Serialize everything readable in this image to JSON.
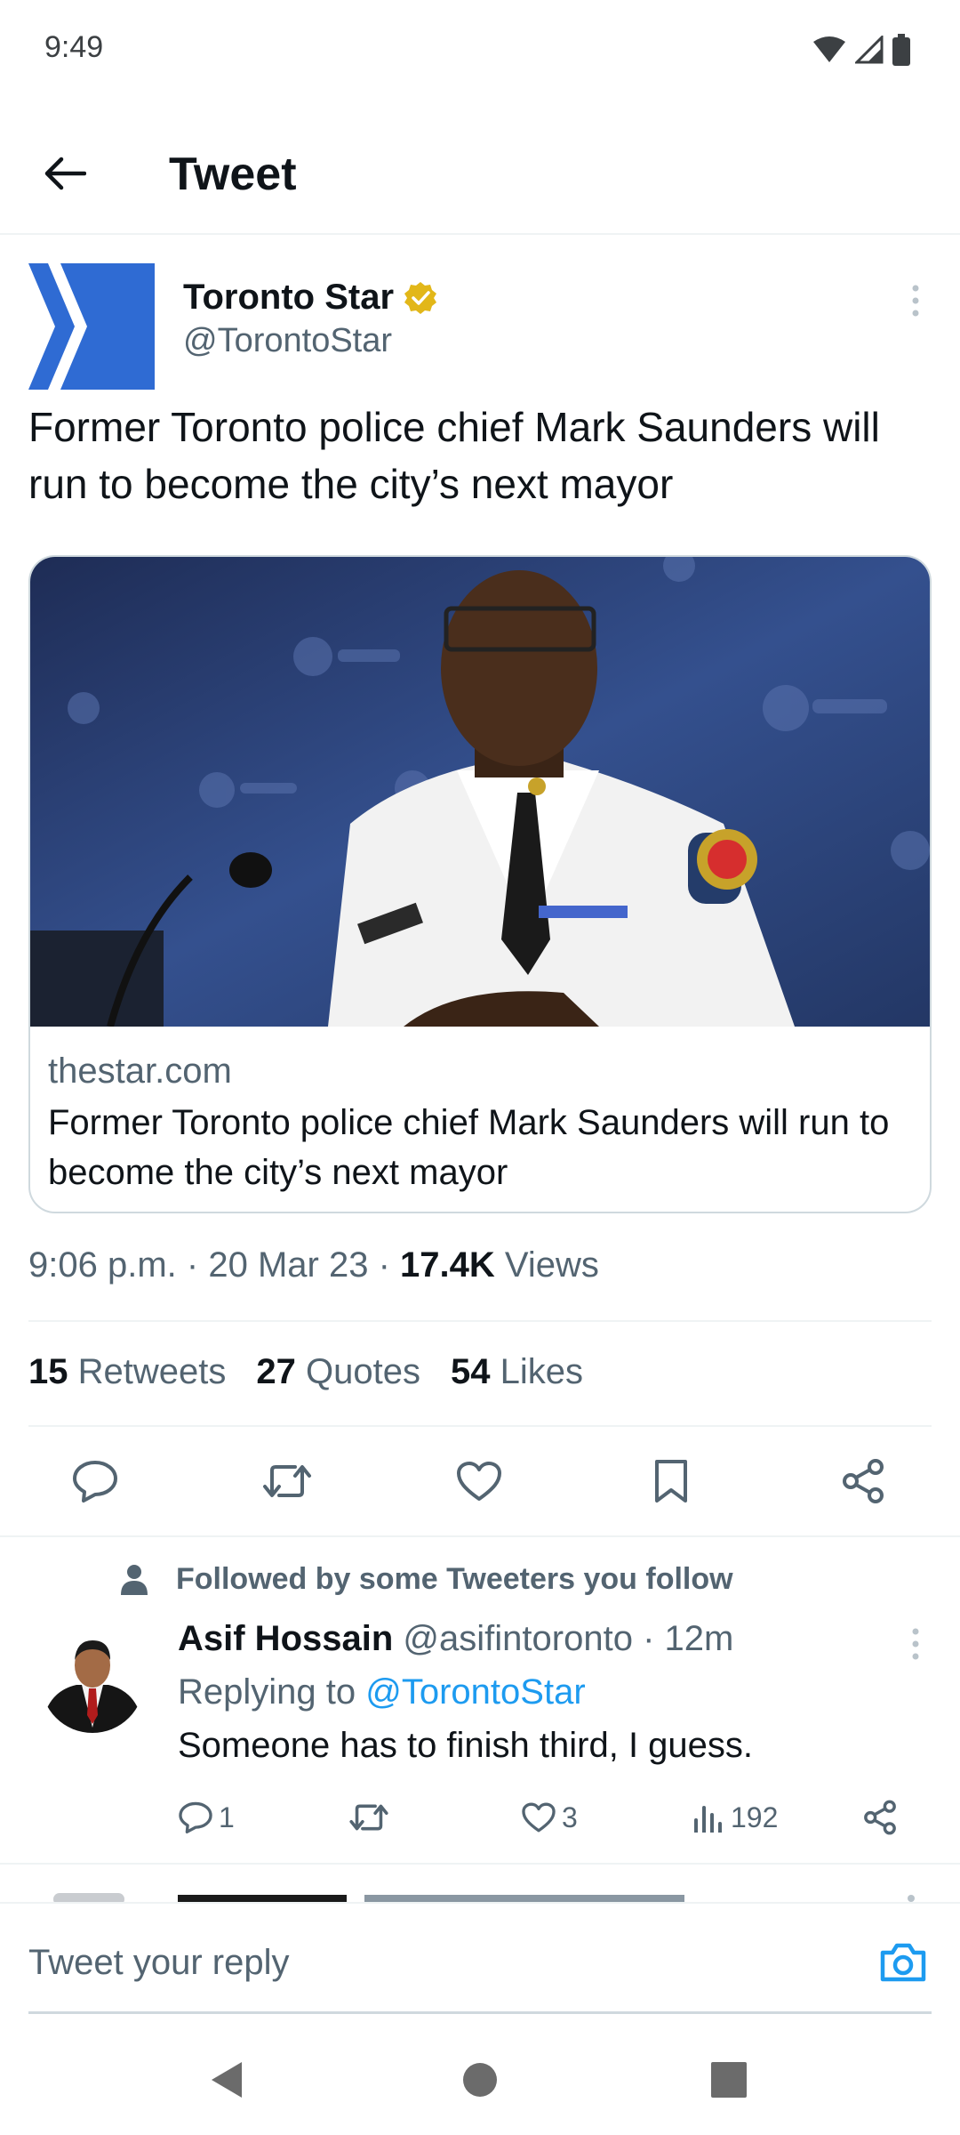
{
  "status_bar": {
    "time": "9:49"
  },
  "top_bar": {
    "title": "Tweet"
  },
  "tweet": {
    "author_name": "Toronto Star",
    "author_handle": "@TorontoStar",
    "text": "Former Toronto police chief Mark Saunders will run to become the city’s next mayor",
    "card": {
      "domain": "thestar.com",
      "title": "Former Toronto police chief Mark Saunders will run to become the city’s next mayor"
    },
    "time": "9:06 p.m.",
    "date": "20 Mar 23",
    "views_count": "17.4K",
    "views_label": "Views",
    "separator": "·",
    "stats": {
      "retweets_count": "15",
      "retweets_label": "Retweets",
      "quotes_count": "27",
      "quotes_label": "Quotes",
      "likes_count": "54",
      "likes_label": "Likes"
    }
  },
  "reply": {
    "social_context": "Followed by some Tweeters you follow",
    "name": "Asif Hossain",
    "handle": "@asifintoronto",
    "time": "· 12m",
    "replying_label": "Replying to",
    "replying_handle": "@TorontoStar",
    "text": "Someone has to finish third, I guess.",
    "reply_count": "1",
    "like_count": "3",
    "view_count": "192"
  },
  "composer": {
    "placeholder": "Tweet your reply"
  },
  "colors": {
    "brand_blue": "#1d9bf0",
    "star_logo_blue": "#2f6bd3",
    "verified_gold": "#e2b719",
    "text_primary": "#0f1419",
    "text_secondary": "#536471"
  },
  "icons": [
    "back-arrow-icon",
    "verified-badge-icon",
    "more-vertical-icon",
    "reply-icon",
    "retweet-icon",
    "like-icon",
    "bookmark-icon",
    "share-icon",
    "person-icon",
    "views-icon",
    "camera-icon",
    "nav-back-icon",
    "nav-home-icon",
    "nav-recents-icon"
  ]
}
